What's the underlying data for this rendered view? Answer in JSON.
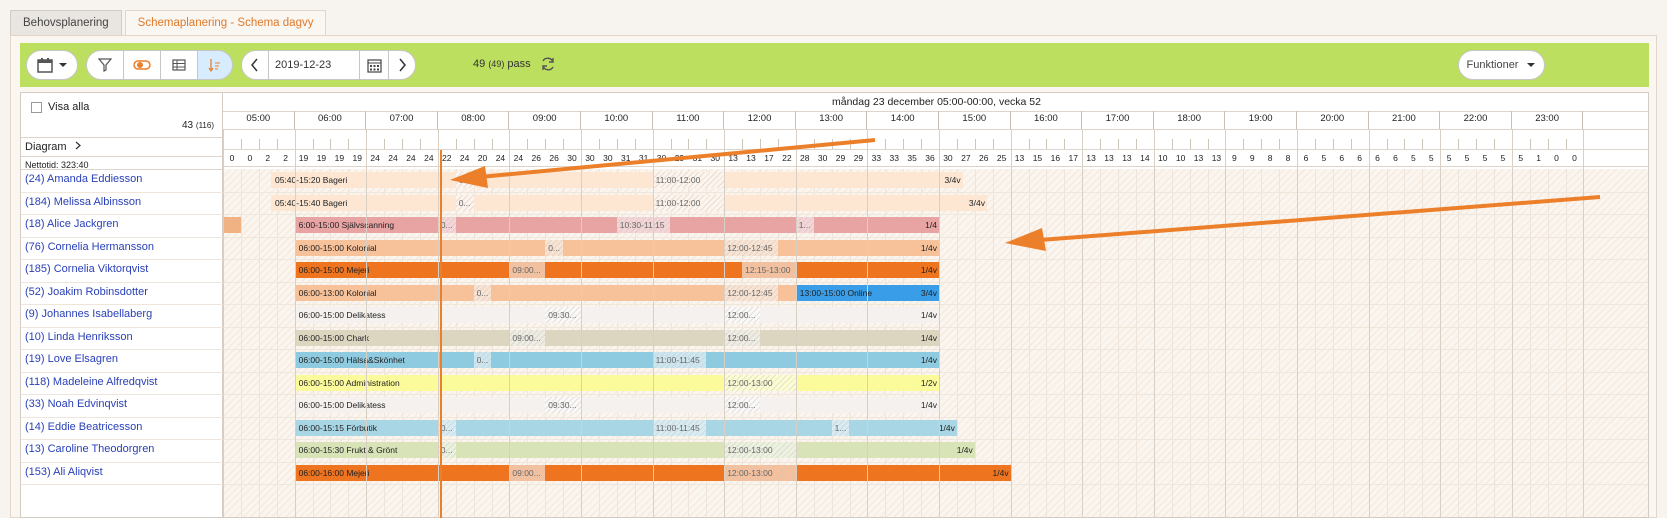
{
  "tabs": [
    {
      "label": "Behovsplanering"
    },
    {
      "label": "Schemaplanering - Schema dagvy"
    }
  ],
  "toolbar": {
    "date": "2019-12-23",
    "pass_count": "49",
    "pass_count_sub": "(49)",
    "pass_label": "pass",
    "funktioner_label": "Funktioner"
  },
  "left": {
    "visa_alla": "Visa alla",
    "count": "43",
    "count_sub": "(116)",
    "diagram": "Diagram",
    "nettotid": "Nettotid: 323:40"
  },
  "header": {
    "title": "måndag 23 december 05:00-00:00, vecka 52",
    "hours": [
      "05:00",
      "06:00",
      "07:00",
      "08:00",
      "09:00",
      "10:00",
      "11:00",
      "12:00",
      "13:00",
      "14:00",
      "15:00",
      "16:00",
      "17:00",
      "18:00",
      "19:00",
      "20:00",
      "21:00",
      "22:00",
      "23:00"
    ]
  },
  "nettotid_values": [
    "0",
    "0",
    "2",
    "2",
    "19",
    "19",
    "19",
    "19",
    "24",
    "24",
    "24",
    "24",
    "22",
    "24",
    "20",
    "24",
    "24",
    "26",
    "26",
    "30",
    "30",
    "30",
    "31",
    "31",
    "30",
    "29",
    "31",
    "30",
    "13",
    "13",
    "17",
    "22",
    "28",
    "30",
    "29",
    "29",
    "33",
    "33",
    "35",
    "36",
    "30",
    "27",
    "26",
    "25",
    "13",
    "15",
    "16",
    "17",
    "13",
    "13",
    "13",
    "14",
    "10",
    "10",
    "13",
    "13",
    "9",
    "9",
    "8",
    "8",
    "6",
    "5",
    "6",
    "6",
    "6",
    "6",
    "5",
    "5",
    "5",
    "5",
    "5",
    "5",
    "5",
    "1",
    "0",
    "0"
  ],
  "employees": [
    {
      "name": "(24) Amanda Eddiesson",
      "bars": [
        {
          "start": 5.67,
          "end": 15.33,
          "label": "05:40-15:20 Bageri",
          "color": "#fde7d3"
        }
      ],
      "breaks": [
        {
          "start": 8.25,
          "end": 8.5,
          "label": "0..."
        },
        {
          "start": 11.0,
          "end": 12.0,
          "label": "11:00-12:00"
        }
      ],
      "frac": "3/4v",
      "frac_at": 15.33
    },
    {
      "name": "(184) Melissa Albinsson",
      "bars": [
        {
          "start": 5.67,
          "end": 15.67,
          "label": "05:40-15:40 Bageri",
          "color": "#fde7d3"
        }
      ],
      "breaks": [
        {
          "start": 8.25,
          "end": 8.5,
          "label": "0..."
        },
        {
          "start": 11.0,
          "end": 12.0,
          "label": "11:00-12:00"
        }
      ],
      "frac": "3/4v",
      "frac_at": 15.67
    },
    {
      "name": "(18) Alice Jackgren",
      "bars": [
        {
          "start": 6.0,
          "end": 15.0,
          "label": "6:00-15:00 Självscanning",
          "color": "#e8a3a3"
        }
      ],
      "breaks": [
        {
          "start": 8.0,
          "end": 8.25,
          "label": "0..."
        },
        {
          "start": 10.5,
          "end": 11.25,
          "label": "10:30-11:15"
        },
        {
          "start": 13.0,
          "end": 13.25,
          "label": "1..."
        }
      ],
      "frac": "1/4",
      "frac_at": 15.0,
      "pre": {
        "start": 5.0,
        "end": 5.25,
        "color": "#f1b283"
      }
    },
    {
      "name": "(76) Cornelia Hermansson",
      "bars": [
        {
          "start": 6.0,
          "end": 15.0,
          "label": "06:00-15:00 Kolonial",
          "color": "#f7c19a"
        }
      ],
      "breaks": [
        {
          "start": 9.5,
          "end": 9.75,
          "label": "0..."
        },
        {
          "start": 12.0,
          "end": 12.75,
          "label": "12:00-12:45"
        }
      ],
      "frac": "1/4v",
      "frac_at": 15.0
    },
    {
      "name": "(185) Cornelia Viktorqvist",
      "bars": [
        {
          "start": 6.0,
          "end": 15.0,
          "label": "06:00-15:00 Mejeri",
          "color": "#ee7420"
        }
      ],
      "breaks": [
        {
          "start": 9.0,
          "end": 9.5,
          "label": "09:00..."
        },
        {
          "start": 12.25,
          "end": 13.0,
          "label": "12:15-13:00"
        }
      ],
      "frac": "1/4v",
      "frac_at": 15.0
    },
    {
      "name": "(52) Joakim Robinsdotter",
      "bars": [
        {
          "start": 6.0,
          "end": 13.0,
          "label": "06:00-13:00 Kolonial",
          "color": "#f7c19a"
        },
        {
          "start": 13.0,
          "end": 15.0,
          "label": "13:00-15:00 Online",
          "color": "#3a9de8"
        }
      ],
      "breaks": [
        {
          "start": 8.5,
          "end": 8.75,
          "label": "0..."
        },
        {
          "start": 12.0,
          "end": 12.75,
          "label": "12:00-12:45"
        }
      ],
      "frac": "3/4v",
      "frac_at": 15.0
    },
    {
      "name": "(9) Johannes Isabellaberg",
      "bars": [
        {
          "start": 6.0,
          "end": 15.0,
          "label": "06:00-15:00 Delikatess",
          "color": "#f4f1ee"
        }
      ],
      "breaks": [
        {
          "start": 9.5,
          "end": 10.0,
          "label": "09:30..."
        },
        {
          "start": 12.0,
          "end": 12.5,
          "label": "12:00..."
        }
      ],
      "frac": "1/4v",
      "frac_at": 15.0
    },
    {
      "name": "(10) Linda Henriksson",
      "bars": [
        {
          "start": 6.0,
          "end": 15.0,
          "label": "06:00-15:00 Chark",
          "color": "#dcd5bf"
        }
      ],
      "breaks": [
        {
          "start": 9.0,
          "end": 9.5,
          "label": "09:00..."
        },
        {
          "start": 12.0,
          "end": 12.5,
          "label": "12:00..."
        }
      ],
      "frac": "1/4v",
      "frac_at": 15.0
    },
    {
      "name": "(19) Love Elsagren",
      "bars": [
        {
          "start": 6.0,
          "end": 15.0,
          "label": "06:00-15:00 Hälsa&Skönhet",
          "color": "#8fcbe0"
        }
      ],
      "breaks": [
        {
          "start": 8.5,
          "end": 8.75,
          "label": "0..."
        },
        {
          "start": 11.0,
          "end": 11.75,
          "label": "11:00-11:45"
        }
      ],
      "frac": "1/4v",
      "frac_at": 15.0
    },
    {
      "name": "(118) Madeleine Alfredqvist",
      "bars": [
        {
          "start": 6.0,
          "end": 15.0,
          "label": "06:00-15:00 Administration",
          "color": "#fbfb9c"
        }
      ],
      "breaks": [
        {
          "start": 12.0,
          "end": 13.0,
          "label": "12:00-13:00"
        }
      ],
      "frac": "1/2v",
      "frac_at": 15.0
    },
    {
      "name": "(33) Noah Edvinqvist",
      "bars": [
        {
          "start": 6.0,
          "end": 15.0,
          "label": "06:00-15:00 Delikatess",
          "color": "#f4f1ee"
        }
      ],
      "breaks": [
        {
          "start": 9.5,
          "end": 10.0,
          "label": "09:30..."
        },
        {
          "start": 12.0,
          "end": 12.5,
          "label": "12:00..."
        }
      ],
      "frac": "1/4v",
      "frac_at": 15.0
    },
    {
      "name": "(14) Eddie Beatricesson",
      "bars": [
        {
          "start": 6.0,
          "end": 15.25,
          "label": "06:00-15:15 Förbutik",
          "color": "#a9d6e5"
        }
      ],
      "breaks": [
        {
          "start": 8.0,
          "end": 8.25,
          "label": "0..."
        },
        {
          "start": 11.0,
          "end": 11.75,
          "label": "11:00-11:45"
        },
        {
          "start": 13.5,
          "end": 13.75,
          "label": "1..."
        }
      ],
      "frac": "1/4v",
      "frac_at": 15.25
    },
    {
      "name": "(13) Caroline Theodorgren",
      "bars": [
        {
          "start": 6.0,
          "end": 15.5,
          "label": "06:00-15:30 Frukt & Grönt",
          "color": "#d8e3b8"
        }
      ],
      "breaks": [
        {
          "start": 8.0,
          "end": 8.25,
          "label": "0..."
        },
        {
          "start": 12.0,
          "end": 13.0,
          "label": "12:00-13:00"
        }
      ],
      "frac": "1/4v",
      "frac_at": 15.5
    },
    {
      "name": "(153) Ali Aliqvist",
      "bars": [
        {
          "start": 6.0,
          "end": 16.0,
          "label": "06:00-16:00 Mejeri",
          "color": "#ee7420"
        }
      ],
      "breaks": [
        {
          "start": 9.0,
          "end": 9.5,
          "label": "09:00..."
        },
        {
          "start": 12.0,
          "end": 13.0,
          "label": "12:00-13:00"
        }
      ],
      "frac": "1/4v",
      "frac_at": 16.0
    }
  ]
}
